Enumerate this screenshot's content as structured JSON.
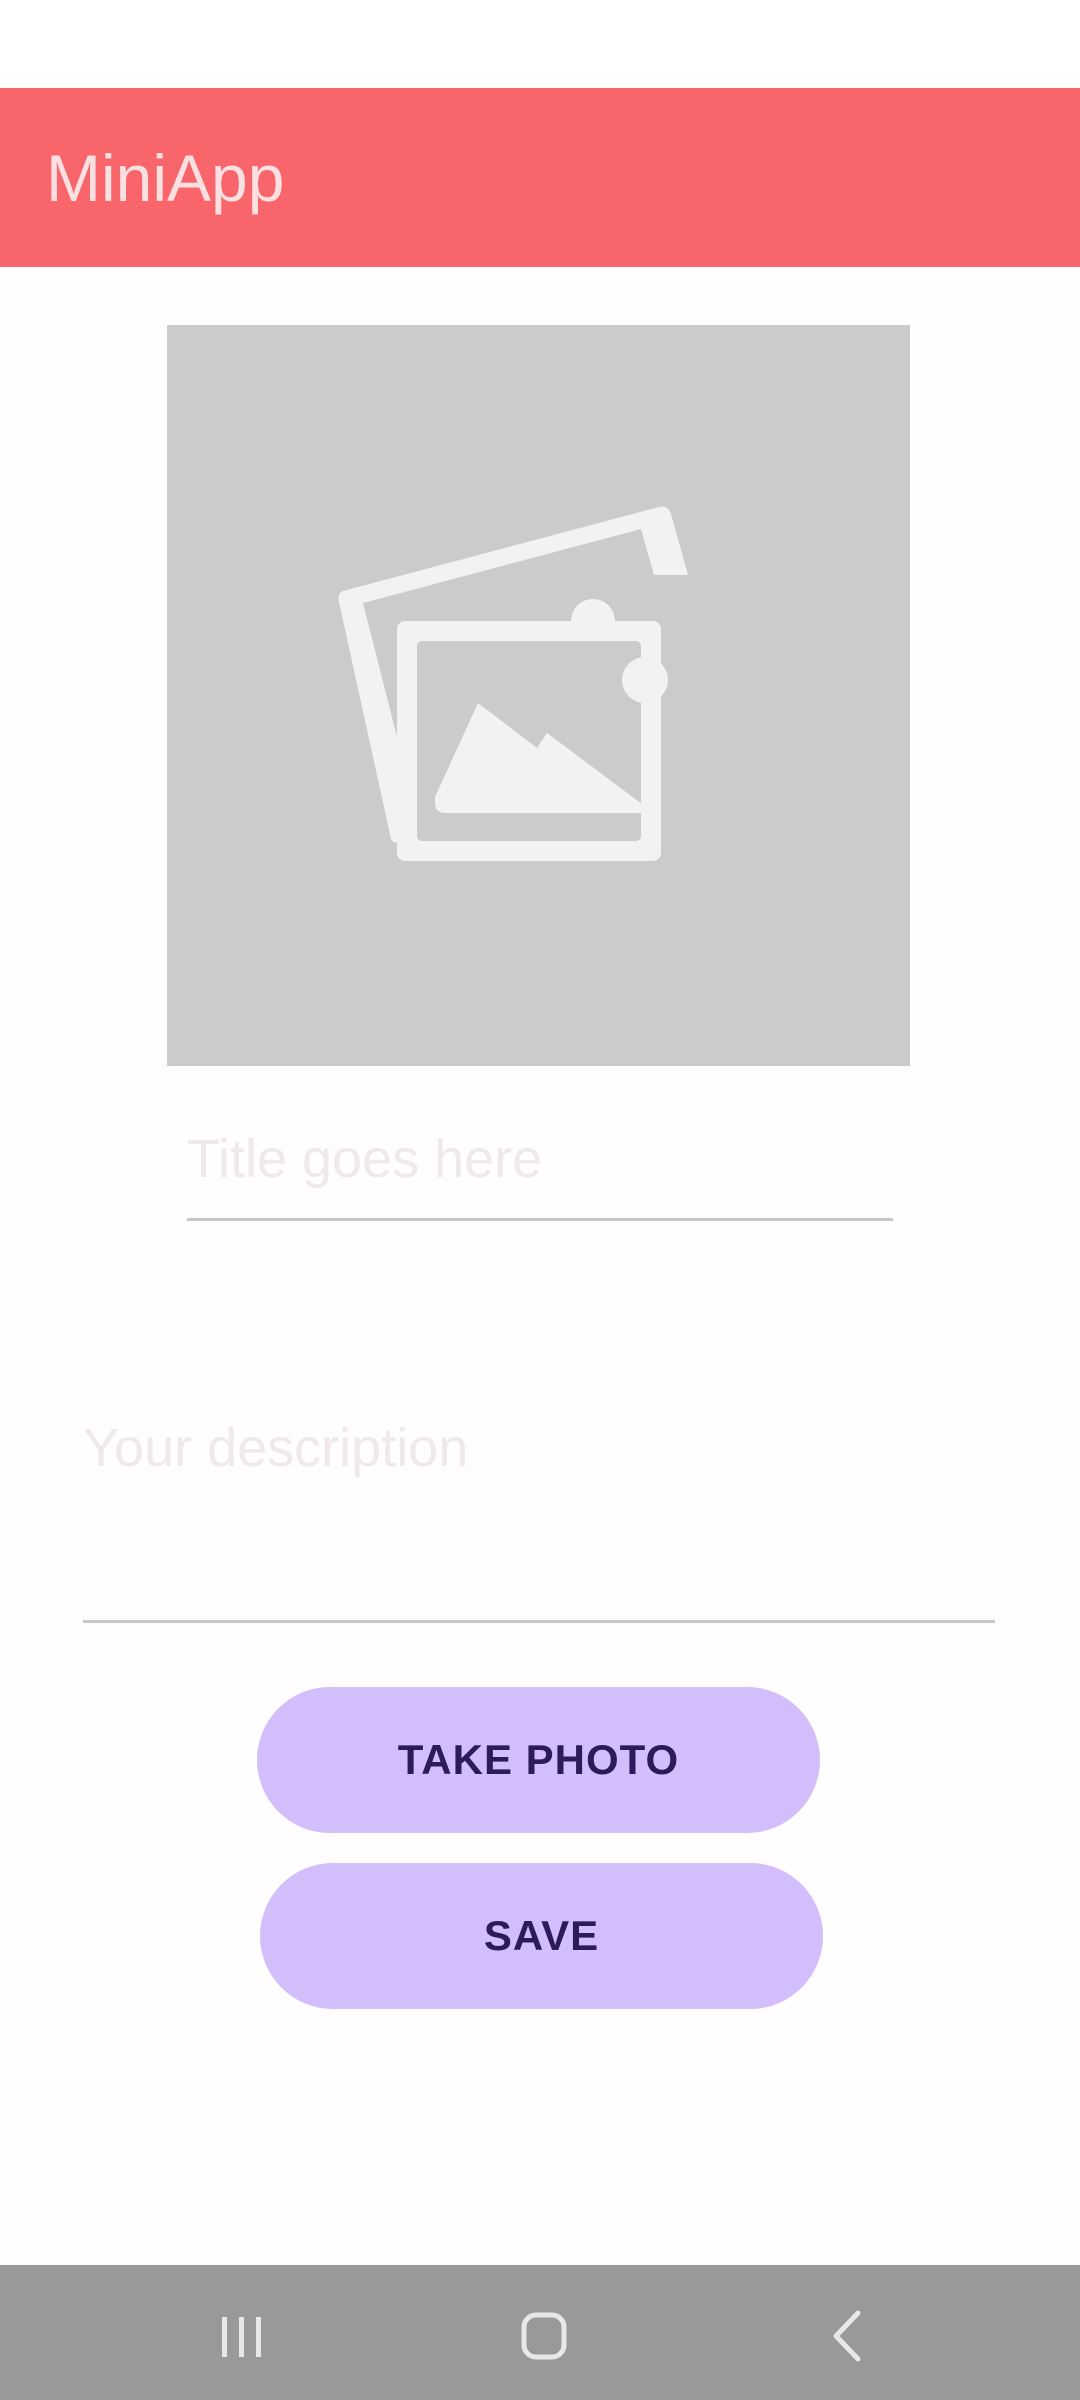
{
  "app": {
    "title": "MiniApp"
  },
  "form": {
    "image_icon": "image-placeholder-icon",
    "title_placeholder": "Title goes here",
    "title_value": "",
    "description_placeholder": "Your description",
    "description_value": ""
  },
  "actions": {
    "take_photo_label": "TAKE PHOTO",
    "save_label": "SAVE"
  },
  "navigation": {
    "recents_icon": "recents-icon",
    "home_icon": "home-icon",
    "back_icon": "back-icon"
  },
  "colors": {
    "app_bar": "#f8656b",
    "button": "#d3bdfb",
    "button_text": "#2c1a5a",
    "image_placeholder": "#cbcbcb",
    "nav_bar": "#999999"
  }
}
